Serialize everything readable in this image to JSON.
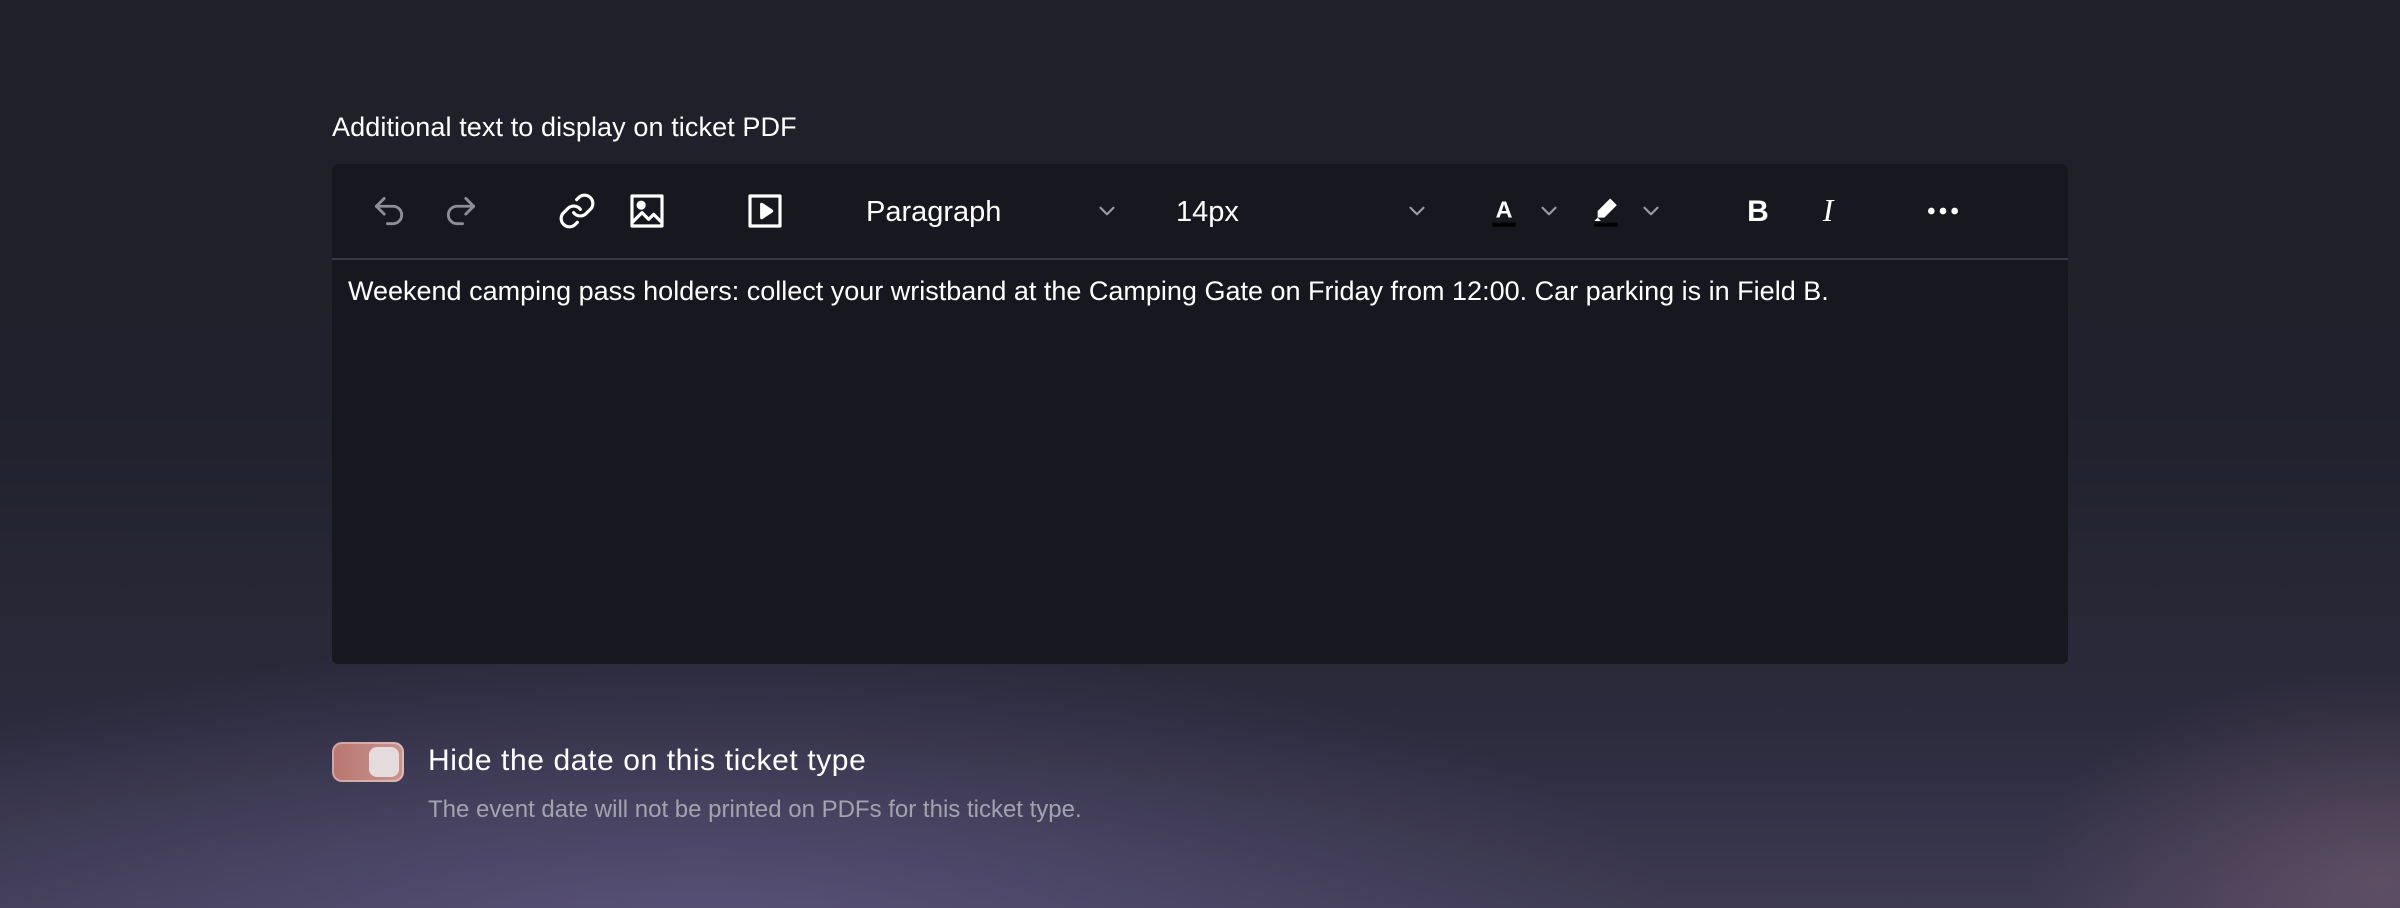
{
  "field": {
    "label": "Additional text to display on ticket PDF"
  },
  "toolbar": {
    "undo_icon": "undo-icon",
    "redo_icon": "redo-icon",
    "link_icon": "link-icon",
    "image_icon": "image-icon",
    "media_icon": "media-play-icon",
    "block_format": "Paragraph",
    "font_size": "14px",
    "text_color_icon": "text-color-icon",
    "highlight_icon": "highlight-marker-icon",
    "bold_icon": "bold-icon",
    "italic_icon": "italic-icon",
    "more_icon": "more-horizontal-icon"
  },
  "editor": {
    "content": "Weekend camping pass holders: collect your wristband at the Camping Gate on Friday from 12:00. Car parking is in Field B."
  },
  "hide_date": {
    "title": "Hide the date on this ticket type",
    "help": "The event date will not be printed on PDFs for this ticket type.",
    "enabled": true,
    "accent_color": "#c08a84"
  }
}
